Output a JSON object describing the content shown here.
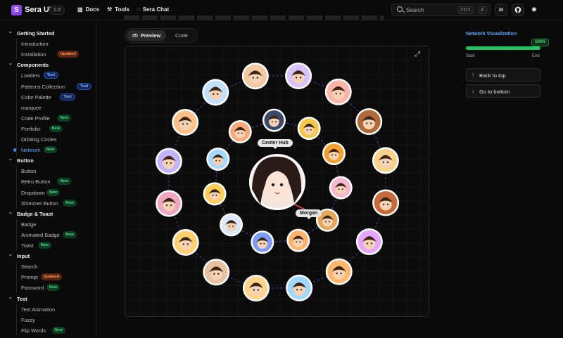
{
  "header": {
    "brand": "Sera UI",
    "version": "1.0",
    "nav": [
      {
        "label": "Docs",
        "icon": "book-icon"
      },
      {
        "label": "Tools",
        "icon": "wrench-icon"
      },
      {
        "label": "Sera Chat",
        "icon": "chat-icon"
      }
    ],
    "search_placeholder": "Search",
    "search_kbd": [
      "Ctrl",
      "K"
    ],
    "linkedin_label": "in"
  },
  "sidebar": [
    {
      "type": "section",
      "label": "Getting Started"
    },
    {
      "type": "item",
      "label": "Introduction"
    },
    {
      "type": "item",
      "label": "Installation",
      "badge": "Updated"
    },
    {
      "type": "section",
      "label": "Components"
    },
    {
      "type": "item",
      "label": "Loaders",
      "badge": "Tool"
    },
    {
      "type": "item",
      "label": "Patterns Collection",
      "badge": "Tool"
    },
    {
      "type": "item",
      "label": "Color Palette",
      "badge": "Tool"
    },
    {
      "type": "item",
      "label": "marquee"
    },
    {
      "type": "item",
      "label": "Code Profile",
      "badge": "New"
    },
    {
      "type": "item",
      "label": "Portfolio",
      "badge": "New"
    },
    {
      "type": "item",
      "label": "Orbiting Circles"
    },
    {
      "type": "item",
      "label": "Network",
      "badge": "New",
      "active": true
    },
    {
      "type": "section",
      "label": "Button"
    },
    {
      "type": "item",
      "label": "Button"
    },
    {
      "type": "item",
      "label": "Retro Button",
      "badge": "New"
    },
    {
      "type": "item",
      "label": "Dropdown",
      "badge": "New"
    },
    {
      "type": "item",
      "label": "Shimmer Button",
      "badge": "New"
    },
    {
      "type": "section",
      "label": "Badge & Toast"
    },
    {
      "type": "item",
      "label": "Badge"
    },
    {
      "type": "item",
      "label": "Animated Badge",
      "badge": "New"
    },
    {
      "type": "item",
      "label": "Toast",
      "badge": "New"
    },
    {
      "type": "section",
      "label": "Input"
    },
    {
      "type": "item",
      "label": "Search"
    },
    {
      "type": "item",
      "label": "Prompt",
      "badge": "Updated"
    },
    {
      "type": "item",
      "label": "Password",
      "badge": "New"
    },
    {
      "type": "section",
      "label": "Text"
    },
    {
      "type": "item",
      "label": "Text Animation"
    },
    {
      "type": "item",
      "label": "Fuzzy"
    },
    {
      "type": "item",
      "label": "Flip Words",
      "badge": "New"
    }
  ],
  "tabs": {
    "preview": "Preview",
    "code": "Code"
  },
  "network": {
    "center_label": "Center Hub",
    "hover_label": "Morgan",
    "line_color": "#6b5bd6",
    "highlight_color": "#ef4444",
    "outer_colors": [
      "#f3c9a0",
      "#d9c2ff",
      "#ffb4a8",
      "#b06a3a",
      "#f7d28a",
      "#c86b3c",
      "#e6a6ff",
      "#ffb86b",
      "#a0d8ff",
      "#ffd58a",
      "#e8c1a0",
      "#ffcf70",
      "#f2a5c0",
      "#c5b2ff",
      "#ffc08a",
      "#bfe0ff"
    ],
    "inner_colors": [
      "#3b4a6b",
      "#f6c84a",
      "#f4a02e",
      "#f7b6d2",
      "#e3a65a",
      "#ffb36b",
      "#7a9cff",
      "#d9e9ff",
      "#ffcc55",
      "#a3d9ff",
      "#f7a97a"
    ]
  },
  "right_panel": {
    "title": "Network Visualization",
    "progress": 100,
    "progress_label": "100%",
    "start_label": "Start",
    "end_label": "End",
    "back_to_top": "Back to top",
    "go_to_bottom": "Go to bottom"
  }
}
